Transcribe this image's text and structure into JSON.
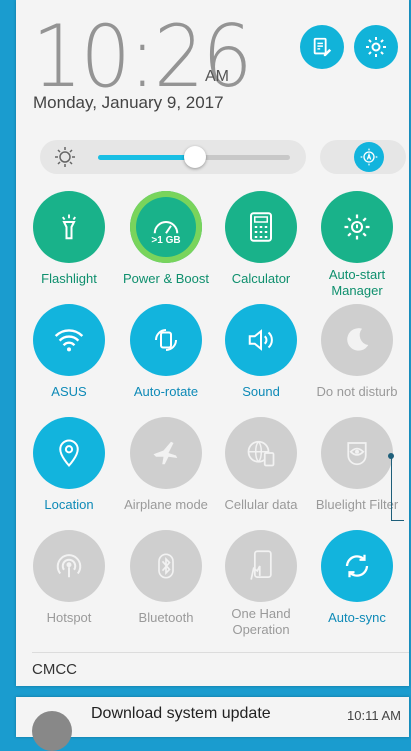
{
  "clock": {
    "time": "10:26",
    "ampm": "AM",
    "date": "Monday, January 9, 2017"
  },
  "header": {
    "edit_icon": "edit-icon",
    "settings_icon": "gear-icon"
  },
  "brightness": {
    "level": 0.5,
    "sun_icon": "sun-icon",
    "auto_icon": "auto-brightness-icon"
  },
  "tiles": [
    {
      "label": "Flashlight",
      "icon": "flashlight-icon",
      "state": "green"
    },
    {
      "label": "Power & Boost",
      "icon": "boost-icon",
      "state": "green",
      "badge": ">1 GB"
    },
    {
      "label": "Calculator",
      "icon": "calculator-icon",
      "state": "green"
    },
    {
      "label": "Auto-start Manager",
      "icon": "autostart-gear-icon",
      "state": "green"
    },
    {
      "label": "ASUS",
      "icon": "wifi-icon",
      "state": "blue"
    },
    {
      "label": "Auto-rotate",
      "icon": "rotate-icon",
      "state": "blue"
    },
    {
      "label": "Sound",
      "icon": "speaker-icon",
      "state": "blue"
    },
    {
      "label": "Do not disturb",
      "icon": "moon-icon",
      "state": "off"
    },
    {
      "label": "Location",
      "icon": "location-icon",
      "state": "blue"
    },
    {
      "label": "Airplane mode",
      "icon": "airplane-icon",
      "state": "off"
    },
    {
      "label": "Cellular data",
      "icon": "cellular-data-icon",
      "state": "off"
    },
    {
      "label": "Bluelight Filter",
      "icon": "eye-icon",
      "state": "off"
    },
    {
      "label": "Hotspot",
      "icon": "hotspot-icon",
      "state": "off"
    },
    {
      "label": "Bluetooth",
      "icon": "bluetooth-icon",
      "state": "off"
    },
    {
      "label": "One Hand Operation",
      "icon": "one-hand-icon",
      "state": "off"
    },
    {
      "label": "Auto-sync",
      "icon": "sync-icon",
      "state": "blue"
    }
  ],
  "carrier": "CMCC",
  "notification": {
    "title": "Download system update",
    "time": "10:11 AM"
  }
}
